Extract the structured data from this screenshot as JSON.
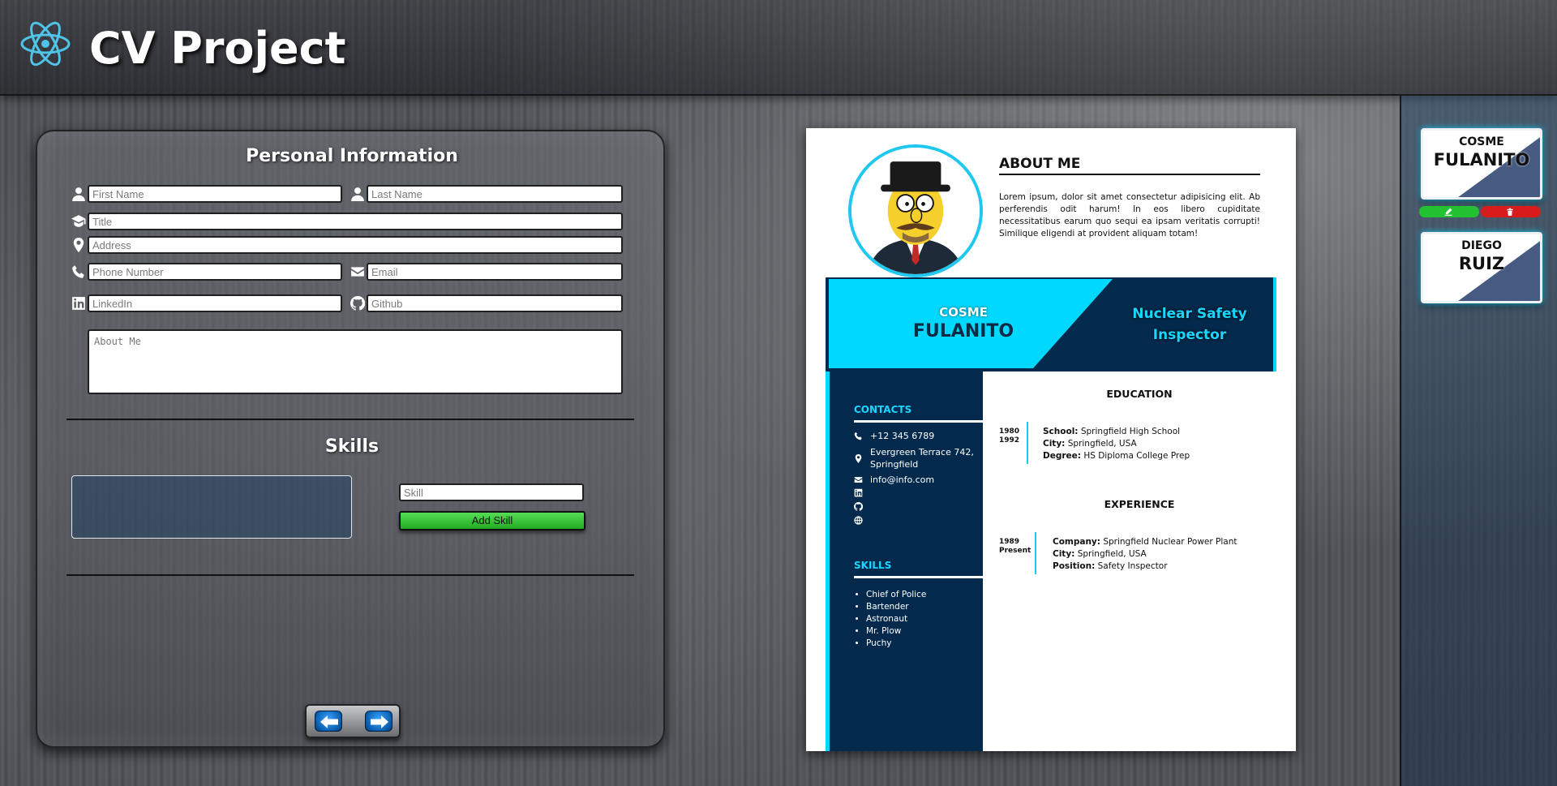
{
  "app": {
    "title": "CV Project",
    "logo_icon": "react-atom-icon"
  },
  "form": {
    "personal_heading": "Personal Information",
    "first_name_placeholder": "First Name",
    "last_name_placeholder": "Last Name",
    "title_placeholder": "Title",
    "address_placeholder": "Address",
    "phone_placeholder": "Phone Number",
    "email_placeholder": "Email",
    "linkedin_placeholder": "LinkedIn",
    "github_placeholder": "Github",
    "about_placeholder": "About Me",
    "skills_heading": "Skills",
    "skill_placeholder": "Skill",
    "add_skill_label": "Add Skill"
  },
  "cv": {
    "about_title": "ABOUT ME",
    "about_text": "Lorem ipsum, dolor sit amet consectetur adipisicing elit. Ab perferendis odit harum! In eos libero cupiditate necessitatibus earum quo sequi ea ipsam veritatis corrupti! Similique eligendi at provident aliquam totam!",
    "first_name": "COSME",
    "last_name": "FULANITO",
    "title": "Nuclear Safety Inspector",
    "contacts_heading": "CONTACTS",
    "phone": "+12 345 6789",
    "address": "Evergreen Terrace 742, Springfield",
    "email": "info@info.com",
    "skills_heading": "SKILLS",
    "skills": [
      "Chief of Police",
      "Bartender",
      "Astronaut",
      "Mr. Plow",
      "Puchy"
    ],
    "education_heading": "EDUCATION",
    "education": {
      "year_start": "1980",
      "year_end": "1992",
      "school_label": "School:",
      "school": "Springfield High School",
      "city_label": "City:",
      "city": "Springfield, USA",
      "degree_label": "Degree:",
      "degree": "HS Diploma College Prep"
    },
    "experience_heading": "EXPERIENCE",
    "experience": {
      "year_start": "1989",
      "year_end": "Present",
      "company_label": "Company:",
      "company": "Springfield Nuclear Power Plant",
      "city_label": "City:",
      "city": "Springfield, USA",
      "position_label": "Position:",
      "position": "Safety Inspector"
    }
  },
  "saved_cvs": [
    {
      "first": "COSME",
      "last": "FULANITO"
    },
    {
      "first": "DIEGO",
      "last": "RUIZ"
    }
  ],
  "colors": {
    "accent": "#00d8ff",
    "navy": "#032a4d",
    "edit": "#22c232",
    "delete": "#d81c1c"
  }
}
